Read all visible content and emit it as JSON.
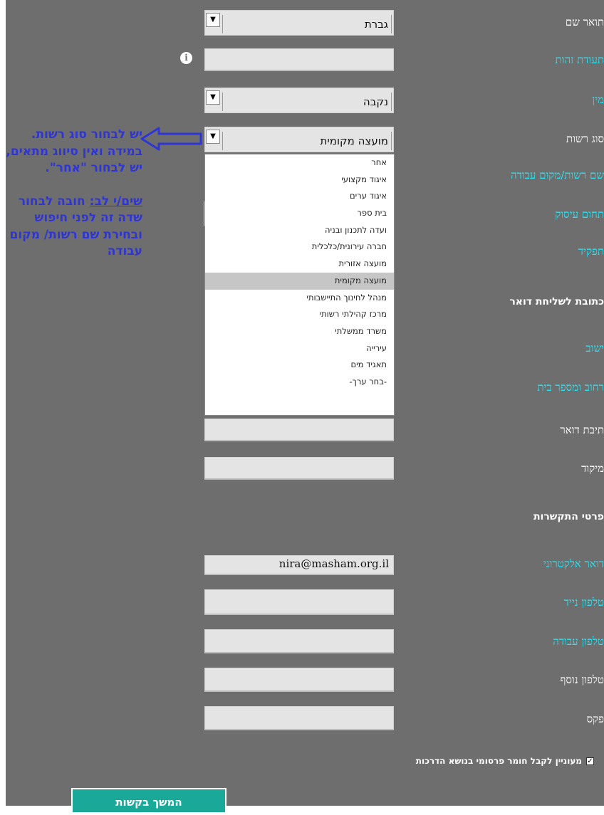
{
  "form": {
    "title_prefix": {
      "label": "תואר שם",
      "value": "גברת"
    },
    "id_number": {
      "label": "תעודת זהות",
      "value": ""
    },
    "gender": {
      "label": "מין",
      "value": "נקבה"
    },
    "authority_type": {
      "label": "סוג רשות",
      "value": "מועצה מקומית"
    },
    "authority_name": {
      "label": "שם רשות/מקום עבודה"
    },
    "occupation_field": {
      "label": "תחום עיסוק"
    },
    "role": {
      "label": "תפקיד"
    },
    "mailing_heading": "כתובת לשליחת דואר",
    "settlement": {
      "label": "ישוב"
    },
    "street": {
      "label": "רחוב ומספר בית"
    },
    "po_box": {
      "label": "תיבת דואר",
      "value": ""
    },
    "zip": {
      "label": "מיקוד",
      "value": ""
    },
    "contact_heading": "פרטי התקשרות",
    "email": {
      "label": "דואר אלקטרוני",
      "value": "nira@masham.org.il"
    },
    "mobile": {
      "label": "טלפון נייד",
      "value": ""
    },
    "work_phone": {
      "label": "טלפון עבודה",
      "value": ""
    },
    "extra_phone": {
      "label": "טלפון נוסף",
      "value": ""
    },
    "fax": {
      "label": "פקס",
      "value": ""
    },
    "newsletter_checkbox": {
      "label": "מעוניין לקבל חומר פרסומי בנושא הדרכות",
      "checked": true
    },
    "continue_button": "המשך בקשות"
  },
  "dropdown_options": [
    "אחר",
    "איגוד מקצועי",
    "איגוד ערים",
    "בית ספר",
    "ועדה לתכנון ובניה",
    "חברה עירונית/כלכלית",
    "מועצה אזורית",
    "מועצה מקומית",
    "מנהל לחינוך התיישבותי",
    "מרכז קהילתי רשותי",
    "משרד ממשלתי",
    "עירייה",
    "תאגיד מים",
    "-בחר ערך-"
  ],
  "highlighted_option": "מועצה מקומית",
  "annotation": {
    "line1": "יש לבחור סוג רשות. במידה ואין סיווג מתאים, יש לבחור \"אחר\".",
    "underlined": "שים/י לב:",
    "line2": " חובה לבחור שדה זה לפני חיפוש ובחירת שם רשות/ מקום עבודה"
  },
  "colors": {
    "panel": "#6e6e6e",
    "label_cyan": "#29e3f2",
    "annotation": "#2f35d4",
    "button": "#1aa898"
  },
  "icons": {
    "info": "info-icon",
    "arrow": "left-arrow-icon",
    "dropdown": "chevron-down-icon",
    "checkbox": "checkmark-icon"
  }
}
